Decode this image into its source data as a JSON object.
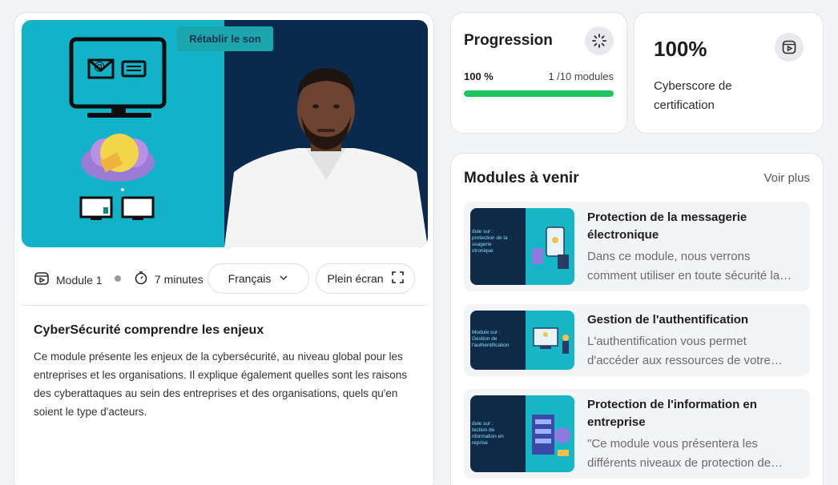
{
  "player": {
    "restore_sound_label": "Rétablir le son"
  },
  "meta": {
    "module_label": "Module 1",
    "duration_label": "7 minutes",
    "language": "Français",
    "fullscreen_label": "Plein écran"
  },
  "description": {
    "title": "CyberSécurité comprendre les enjeux",
    "body": "Ce module présente les enjeux de la cybersécurité, au niveau global pour les entreprises et les organisations. Il explique également quelles sont les raisons des cyberattaques au sein des entreprises et des organisations, quels qu'en soient le type d'acteurs."
  },
  "progression": {
    "title": "Progression",
    "percent_label": "100 %",
    "modules_done": "1",
    "modules_total_label": "/10 modules",
    "progress_fraction": 1.0
  },
  "cyberscore": {
    "value": "100%",
    "label": "Cyberscore de certification"
  },
  "upcoming": {
    "title": "Modules à venir",
    "see_more": "Voir plus",
    "items": [
      {
        "thumb_text": "dule sur :\nprotection de la\nssagerie\nctronique",
        "title": "Protection de la messagerie électronique",
        "description": "Dans ce module, nous verrons comment utiliser en toute sécurité la messagerie électronique"
      },
      {
        "thumb_text": "Module sur :\nGestion de\nl'authentification",
        "title": "Gestion de l'authentification",
        "description": "L'authentification vous permet d'accéder aux ressources de votre entreprise"
      },
      {
        "thumb_text": "dule sur :\ntection de\nnformation en\nreprise",
        "title": "Protection de l'information en entreprise",
        "description": "\"Ce module vous présentera les différents niveaux de protection de l'information"
      }
    ]
  },
  "colors": {
    "accent_green": "#1ec65f",
    "video_teal": "#12b2c9",
    "video_navy": "#0a2a4d"
  }
}
